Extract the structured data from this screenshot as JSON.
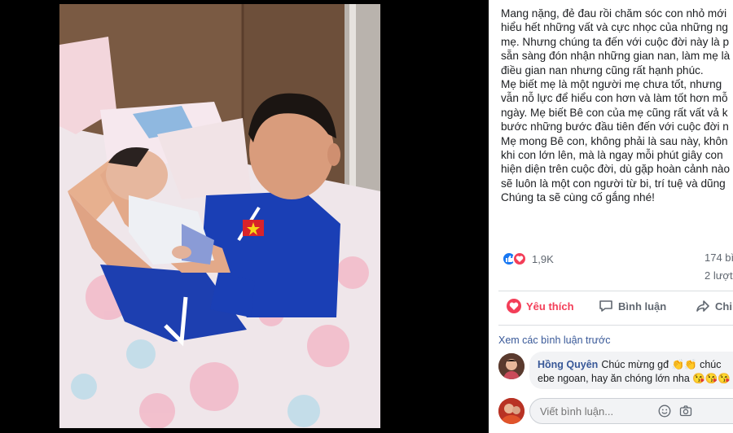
{
  "post": {
    "lines": [
      "Mang nặng, đẻ đau rồi chăm sóc con nhỏ mới",
      "hiểu hết những vất và cực nhọc của những ng",
      "mẹ. Nhưng chúng ta đến với cuộc đời này là p",
      "sẵn sàng đón nhận những gian nan, làm mẹ là",
      "điều gian nan nhưng cũng rất hạnh phúc.",
      "Mẹ biết mẹ là một người mẹ chưa tốt, nhưng",
      "vẫn nỗ lực để hiểu con hơn và làm tốt hơn mỗ",
      "ngày. Mẹ biết Bê con của mẹ cũng rất vất vả k",
      "bước những bước đầu tiên đến với cuộc đời n",
      "Mẹ mong Bê con, không phải là sau này, khôn",
      "khi con lớn lên, mà là ngay mỗi phút giây con",
      "hiện diện trên cuộc đời, dù gặp hoàn cảnh nào",
      "sẽ luôn là một con người từ bi, trí tuệ và dũng",
      "Chúng ta sẽ cùng cố gắng nhé!"
    ]
  },
  "stats": {
    "reactions_count": "1,9K",
    "comments": "174 bì",
    "shares": "2 lượt"
  },
  "actions": {
    "like": "Yêu thích",
    "comment": "Bình luận",
    "share": "Chi"
  },
  "comments": {
    "view_previous": "Xem các bình luận trước",
    "items": [
      {
        "author": "Hồng Quyên",
        "text_line1": "Chúc mừng gđ 👏👏 chúc",
        "text_line2": "ebe ngoan, hay ăn chóng lớn nha 😘😘😘"
      }
    ]
  },
  "composer": {
    "placeholder": "Viết bình luận..."
  },
  "colors": {
    "love": "#f33e58",
    "like": "#1877f2",
    "link": "#385898",
    "jersey": "#1a3fb5"
  },
  "icons": {
    "like": "thumbs-up-icon",
    "love": "heart-icon",
    "comment": "speech-bubble-icon",
    "share": "share-arrow-icon",
    "emoji": "smiley-icon",
    "camera": "camera-icon"
  }
}
